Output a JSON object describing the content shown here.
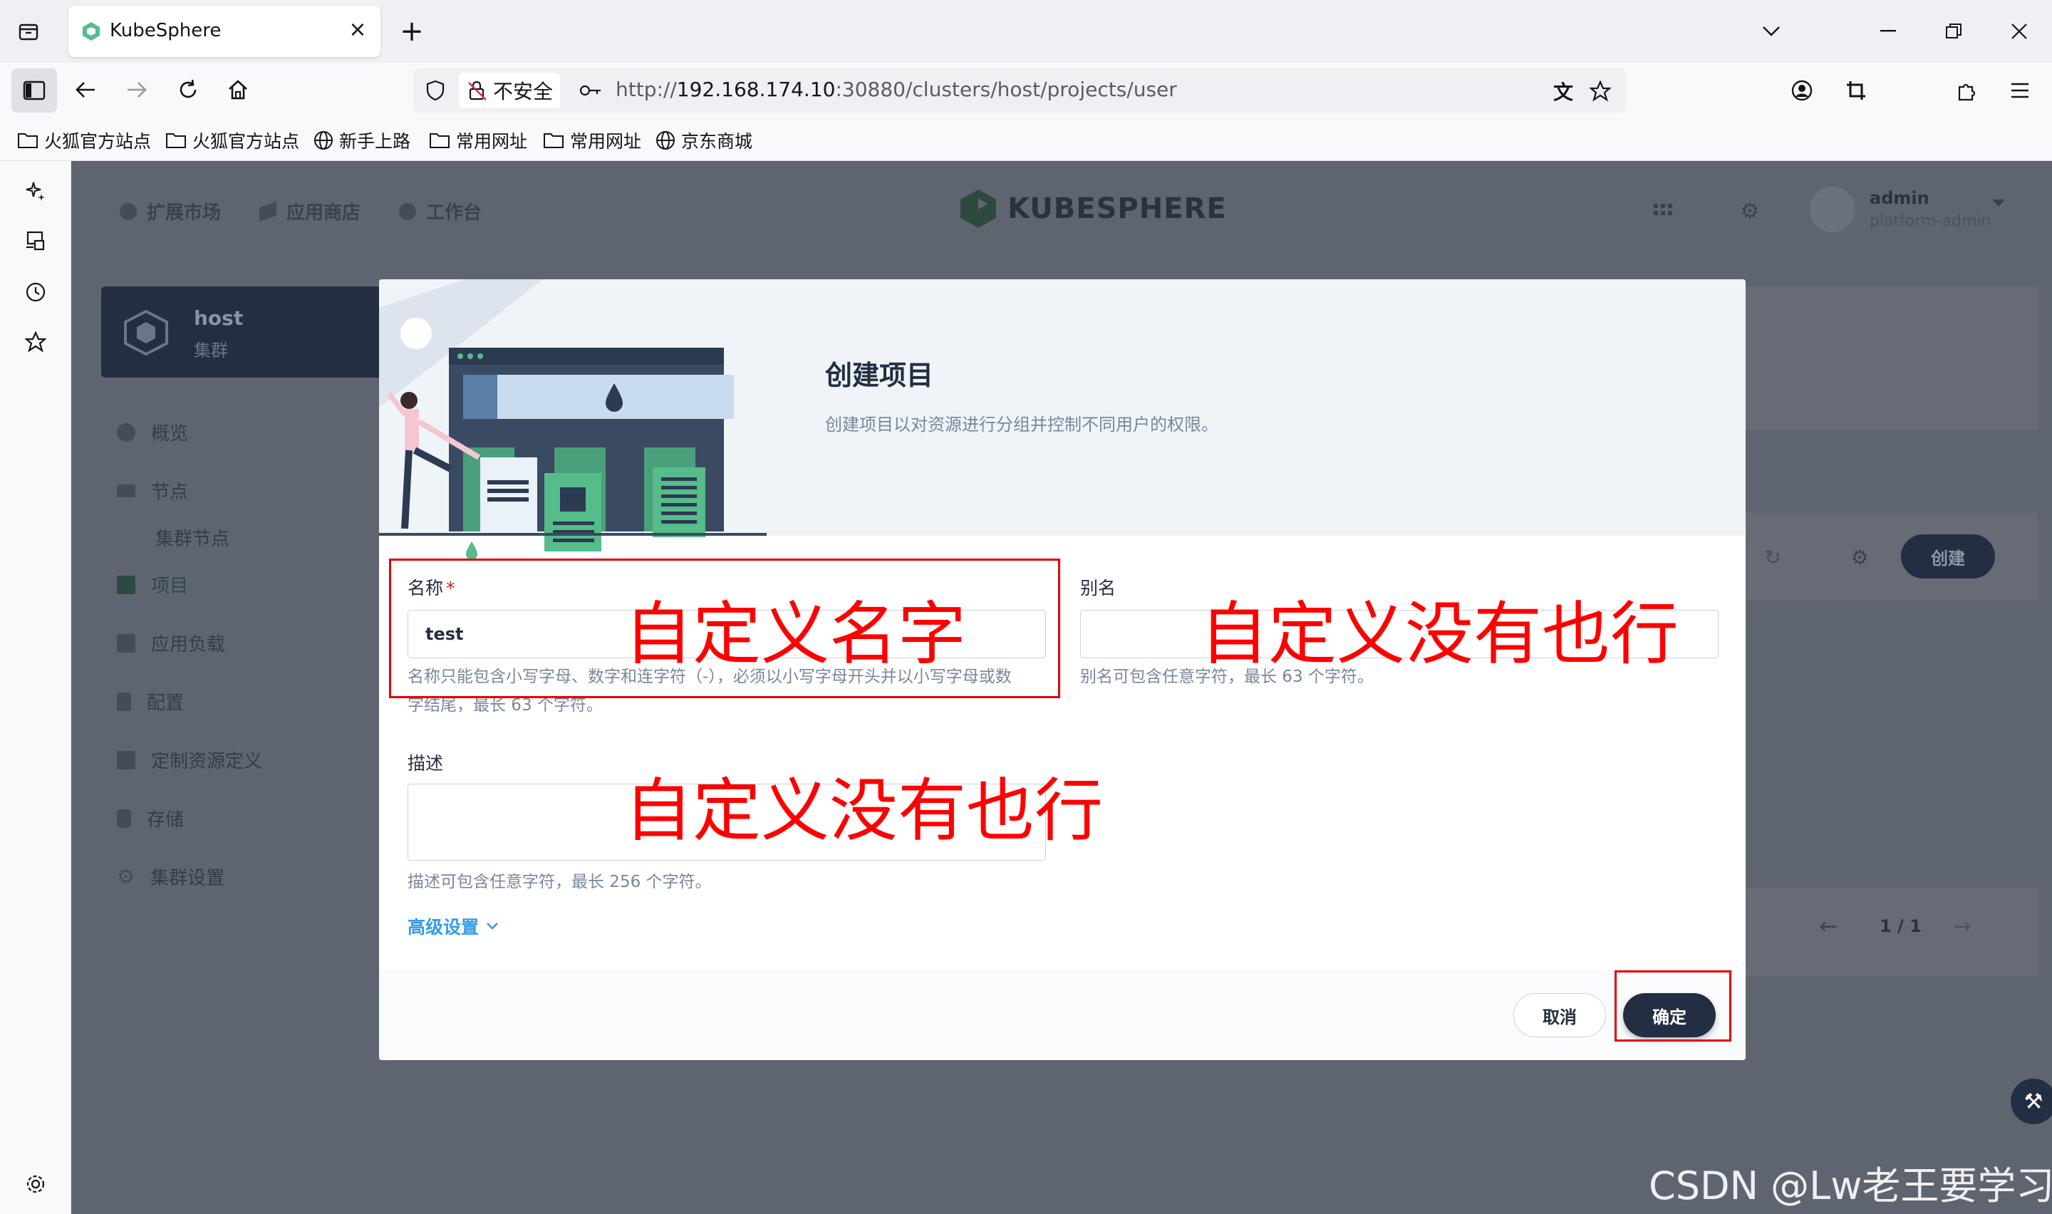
{
  "browser": {
    "tab_title": "KubeSphere",
    "insecure_label": "不安全",
    "url_scheme": "http://",
    "url_host": "192.168.174.10",
    "url_rest": ":30880/clusters/host/projects/user",
    "bookmarks": [
      "火狐官方站点",
      "火狐官方站点",
      "新手上路",
      "常用网址",
      "常用网址",
      "京东商城"
    ]
  },
  "header": {
    "nav": [
      "扩展市场",
      "应用商店",
      "工作台"
    ],
    "logo": "KUBESPHERE",
    "user_name": "admin",
    "user_role": "platform-admin"
  },
  "cluster": {
    "name": "host",
    "sub": "集群"
  },
  "sidebar": {
    "items": [
      "概览",
      "节点",
      "集群节点",
      "项目",
      "应用负载",
      "配置",
      "定制资源定义",
      "存储",
      "集群设置"
    ]
  },
  "background": {
    "create_label": "创建",
    "pager": "1 / 1"
  },
  "modal": {
    "title": "创建项目",
    "description": "创建项目以对资源进行分组并控制不同用户的权限。",
    "name_label": "名称",
    "name_required": "*",
    "name_value": "test",
    "name_hint_line1": "名称只能包含小写字母、数字和连字符（-），必须以小写字母开头并以小写字母或数",
    "name_hint_line2": "字结尾，最长 63 个字符。",
    "alias_label": "别名",
    "alias_hint": "别名可包含任意字符，最长 63 个字符。",
    "desc_label": "描述",
    "desc_hint": "描述可包含任意字符，最长 256 个字符。",
    "advanced": "高级设置",
    "cancel": "取消",
    "ok": "确定"
  },
  "annotations": {
    "name": "自定义名字",
    "alias": "自定义没有也行",
    "desc": "自定义没有也行"
  },
  "watermark": "CSDN @Lw老王要学习",
  "colors": {
    "accent": "#369ce5",
    "dark": "#242e42",
    "annotation": "#ff0000",
    "green": "#55bc8a"
  }
}
